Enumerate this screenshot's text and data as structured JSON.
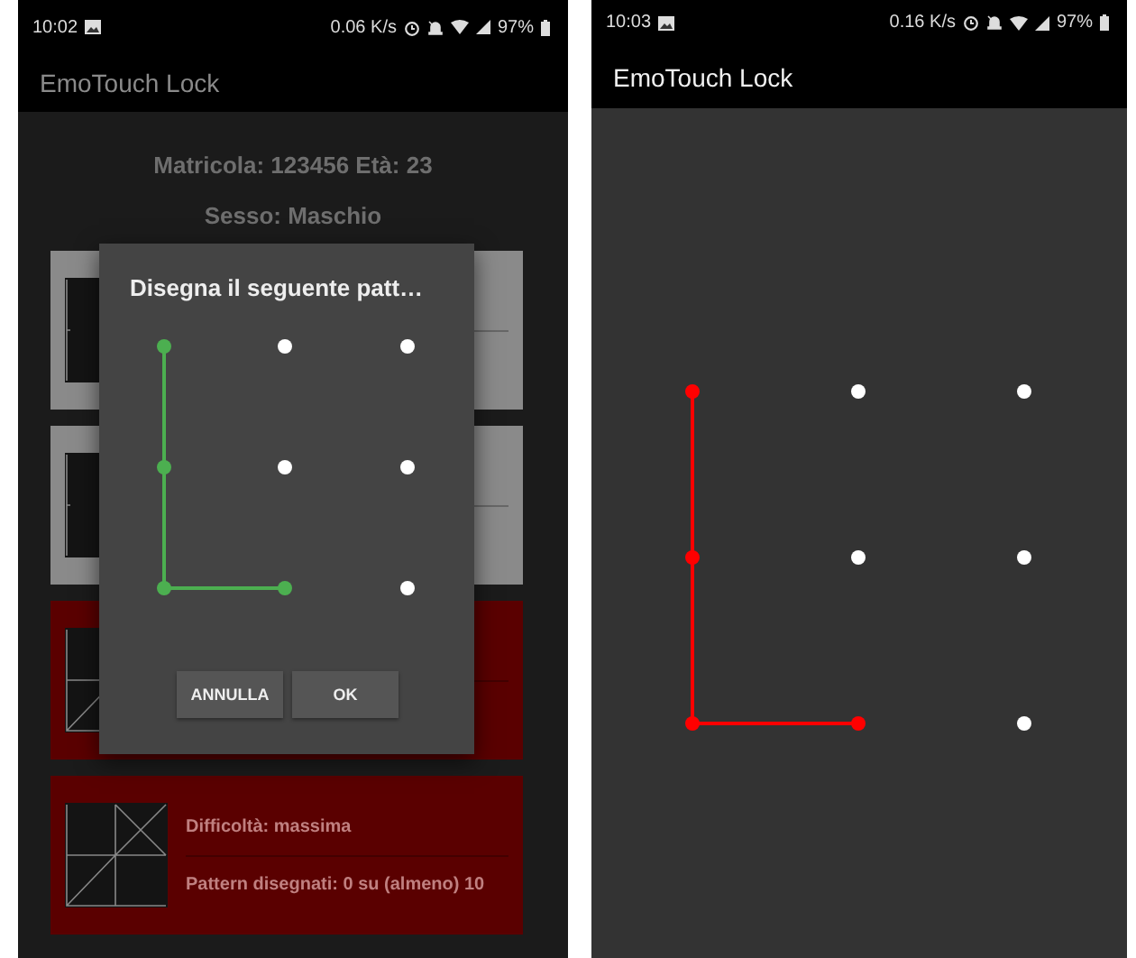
{
  "screens": [
    {
      "status_bar": {
        "time": "10:02",
        "speed": "0.06 K/s",
        "battery": "97%"
      },
      "app_bar": {
        "title": "EmoTouch Lock",
        "dimmed": true
      },
      "header": {
        "line_1": "Matricola: 123456  Età: 23",
        "line_2": "Sesso: Maschio"
      },
      "cards": [
        {
          "color": "#8a8a8a"
        },
        {
          "color": "#8a8a8a"
        },
        {
          "color": "#5a0000"
        },
        {
          "color": "#5a0000",
          "difficulty": "Difficoltà: massima",
          "progress": "Pattern disegnati: 0 su (almeno) 10"
        }
      ],
      "dialog": {
        "title": "Disegna il seguente patt…",
        "buttons": [
          "ANNULLA",
          "OK"
        ],
        "pattern": {
          "color": "#4caf50",
          "dots": [
            {
              "selected": true
            },
            {
              "selected": false
            },
            {
              "selected": false
            },
            {
              "selected": true
            },
            {
              "selected": false
            },
            {
              "selected": false
            },
            {
              "selected": true
            },
            {
              "selected": true
            },
            {
              "selected": false
            }
          ]
        }
      }
    },
    {
      "status_bar": {
        "time": "10:03",
        "speed": "0.16 K/s",
        "battery": "97%"
      },
      "app_bar": {
        "title": "EmoTouch Lock",
        "dimmed": false
      },
      "pattern": {
        "color": "#ff0000",
        "dots": [
          {
            "selected": true
          },
          {
            "selected": false
          },
          {
            "selected": false
          },
          {
            "selected": true
          },
          {
            "selected": false
          },
          {
            "selected": false
          },
          {
            "selected": true
          },
          {
            "selected": true
          },
          {
            "selected": false
          }
        ]
      }
    }
  ]
}
